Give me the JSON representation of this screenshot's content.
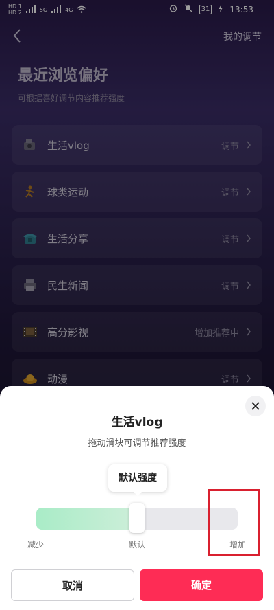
{
  "status_bar": {
    "hd1": "HD 1",
    "hd2": "HD 2",
    "net1": "5G",
    "net2": "4G",
    "battery": "31",
    "time": "13:53"
  },
  "header": {
    "right_link": "我的调节"
  },
  "page": {
    "title": "最近浏览偏好",
    "subtitle": "可根据喜好调节内容推荐强度"
  },
  "items": [
    {
      "name": "生活vlog",
      "action": "调节",
      "icon": "vlog-icon"
    },
    {
      "name": "球类运动",
      "action": "调节",
      "icon": "ball-sports-icon"
    },
    {
      "name": "生活分享",
      "action": "调节",
      "icon": "telephone-icon"
    },
    {
      "name": "民生新闻",
      "action": "调节",
      "icon": "printer-icon"
    },
    {
      "name": "高分影视",
      "action": "增加推荐中",
      "icon": "film-icon"
    },
    {
      "name": "动漫",
      "action": "调节",
      "icon": "hat-icon"
    }
  ],
  "sheet": {
    "title": "生活vlog",
    "subtitle": "拖动滑块可调节推荐强度",
    "tooltip": "默认强度",
    "slider": {
      "value": 0.5,
      "label_min": "减少",
      "label_default": "默认",
      "label_max": "增加"
    },
    "cancel_label": "取消",
    "confirm_label": "确定"
  },
  "colors": {
    "accent": "#fe2c55",
    "slider_fill": "#a9ecc7",
    "highlight_box": "#d9202f"
  }
}
